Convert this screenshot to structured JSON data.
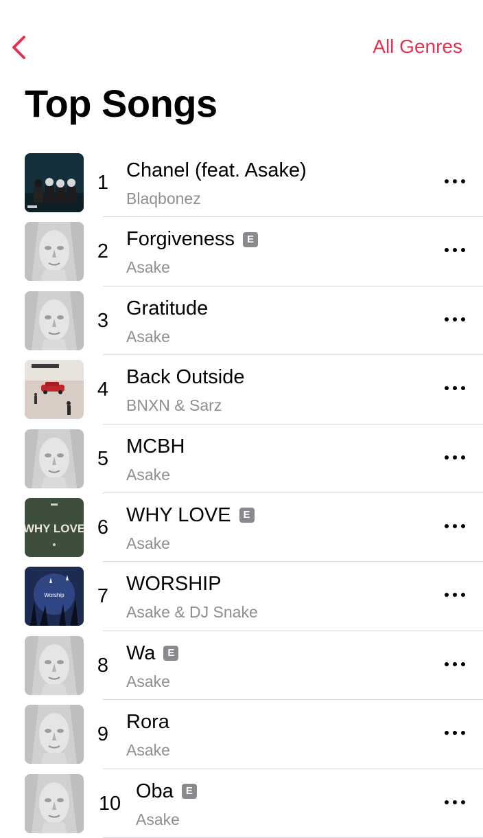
{
  "nav": {
    "back_icon": "chevron-left-icon",
    "right_action": "All Genres",
    "accent_color": "#e53050"
  },
  "page": {
    "title": "Top Songs"
  },
  "songs": [
    {
      "rank": "1",
      "title": "Chanel (feat. Asake)",
      "artist": "Blaqbonez",
      "explicit": false,
      "art": "dark-group-cover"
    },
    {
      "rank": "2",
      "title": "Forgiveness",
      "artist": "Asake",
      "explicit": true,
      "art": "white-sculpture-face-cover"
    },
    {
      "rank": "3",
      "title": "Gratitude",
      "artist": "Asake",
      "explicit": false,
      "art": "white-sculpture-face-cover"
    },
    {
      "rank": "4",
      "title": "Back Outside",
      "artist": "BNXN & Sarz",
      "explicit": false,
      "art": "red-car-street-cover"
    },
    {
      "rank": "5",
      "title": "MCBH",
      "artist": "Asake",
      "explicit": false,
      "art": "white-sculpture-face-cover"
    },
    {
      "rank": "6",
      "title": "WHY LOVE",
      "artist": "Asake",
      "explicit": true,
      "art": "why-love-green-cover"
    },
    {
      "rank": "7",
      "title": "WORSHIP",
      "artist": "Asake & DJ Snake",
      "explicit": false,
      "art": "raised-hands-blue-cover"
    },
    {
      "rank": "8",
      "title": "Wa",
      "artist": "Asake",
      "explicit": true,
      "art": "white-sculpture-face-cover"
    },
    {
      "rank": "9",
      "title": "Rora",
      "artist": "Asake",
      "explicit": false,
      "art": "white-sculpture-face-cover"
    },
    {
      "rank": "10",
      "title": "Oba",
      "artist": "Asake",
      "explicit": true,
      "art": "white-sculpture-face-cover"
    }
  ],
  "explicit_badge": "E",
  "more_icon": "ellipsis-icon",
  "cover_texts": {
    "why_love": "WHY LOVE",
    "worship": "Worship"
  }
}
